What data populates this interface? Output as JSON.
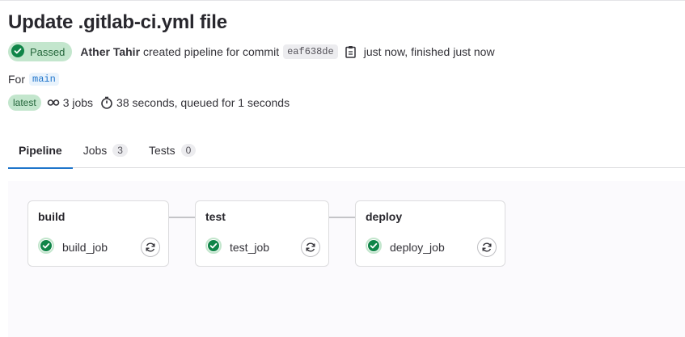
{
  "pipeline": {
    "title": "Update .gitlab-ci.yml file",
    "status_label": "Passed",
    "author": "Ather Tahir",
    "created_text": "created pipeline for commit",
    "commit_sha": "eaf638de",
    "time_text": "just now, finished just now",
    "for_label": "For",
    "ref": "main",
    "latest_badge": "latest",
    "jobs_count_text": "3 jobs",
    "duration_text": "38 seconds, queued for 1 seconds",
    "status_color": "#108548"
  },
  "tabs": [
    {
      "label": "Pipeline",
      "count": ""
    },
    {
      "label": "Jobs",
      "count": "3"
    },
    {
      "label": "Tests",
      "count": "0"
    }
  ],
  "stages": [
    {
      "name": "build",
      "job": "build_job"
    },
    {
      "name": "test",
      "job": "test_job"
    },
    {
      "name": "deploy",
      "job": "deploy_job"
    }
  ],
  "icons": {
    "status": "check-circle-icon",
    "copy": "clipboard-icon",
    "jobs": "pipeline-jobs-icon",
    "duration": "timer-icon",
    "retry": "retry-icon"
  }
}
